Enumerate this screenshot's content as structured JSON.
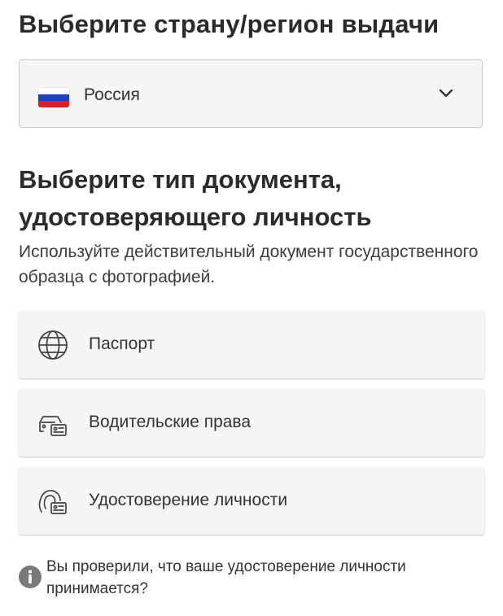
{
  "country_section": {
    "heading": "Выберите страну/регион выдачи",
    "selected_country": "Россия",
    "flag_colors": [
      "#ffffff",
      "#1f3fc2",
      "#d6202b"
    ]
  },
  "document_section": {
    "heading": "Выберите тип документа, удостоверяющего личность",
    "subtitle": "Используйте действительный документ государственного образца с фотографией.",
    "options": [
      {
        "label": "Паспорт",
        "icon": "globe-icon"
      },
      {
        "label": "Водительские права",
        "icon": "car-id-icon"
      },
      {
        "label": "Удостоверение личности",
        "icon": "person-id-icon"
      }
    ]
  },
  "info": {
    "icon": "info-icon",
    "text": "Вы проверили, что ваше удостоверение личности принимается?"
  }
}
